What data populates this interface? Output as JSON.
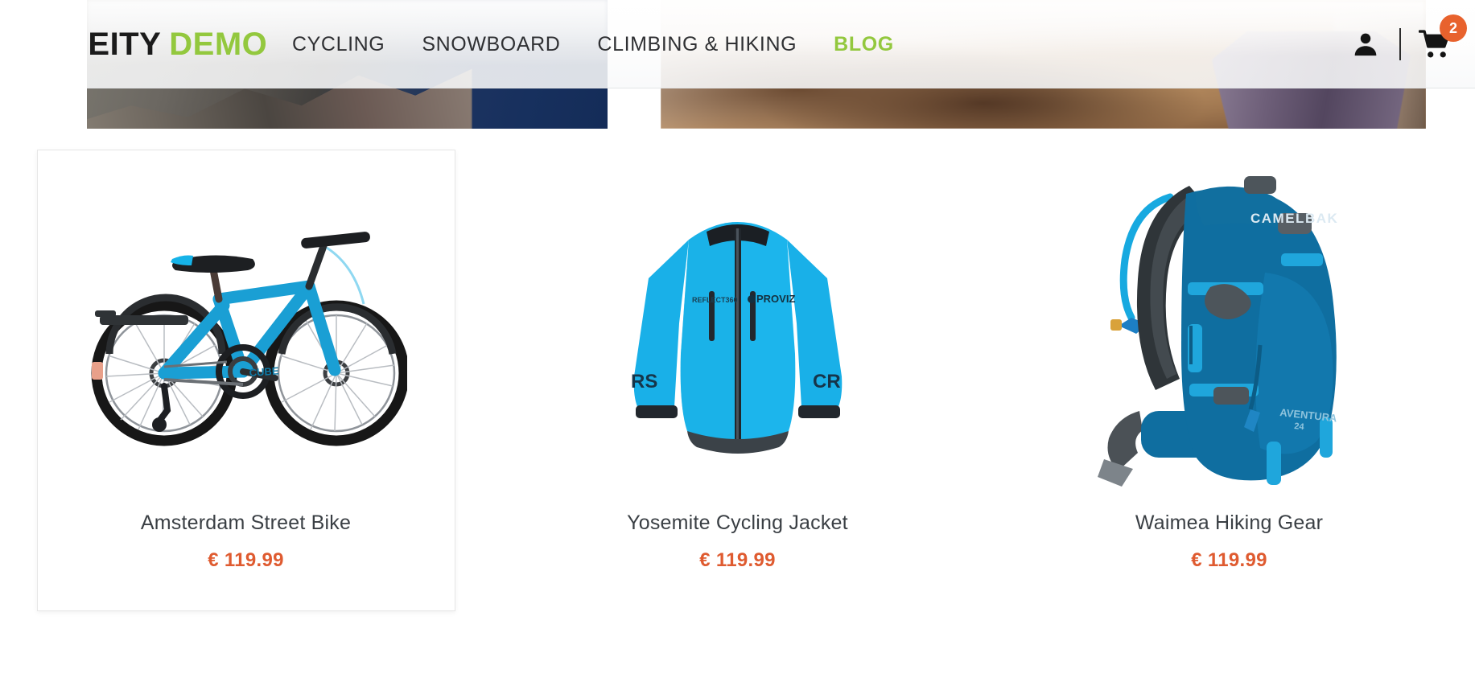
{
  "site": {
    "logo": {
      "mark_icon": "deity-hexagon-logo-icon",
      "name_primary": "DEITY",
      "name_secondary": "DEMO",
      "primary_color": "#1b1b1b",
      "secondary_color": "#93c83e"
    }
  },
  "header": {
    "nav": [
      {
        "label": "CYCLING",
        "active": false,
        "name": "nav-item-cycling"
      },
      {
        "label": "SNOWBOARD",
        "active": false,
        "name": "nav-item-snowboard"
      },
      {
        "label": "CLIMBING & HIKING",
        "active": false,
        "name": "nav-item-climbing-hiking"
      },
      {
        "label": "BLOG",
        "active": true,
        "name": "nav-item-blog"
      }
    ],
    "account_icon": "user-account-icon",
    "cart_icon": "shopping-cart-icon",
    "cart_count": "2",
    "cart_badge_color": "#e8622d",
    "active_nav_color": "#93c83e"
  },
  "hero": {
    "tiles": [
      {
        "name": "hero-banner-mountain",
        "alt": "rocky mountain ridge against deep blue sky"
      },
      {
        "name": "hero-banner-trail",
        "alt": "warm brown hiking trail with purple jacket"
      }
    ]
  },
  "products": [
    {
      "name": "product-card-amsterdam-street-bike",
      "title": "Amsterdam Street Bike",
      "price": "€ 119.99",
      "image_name": "bicycle-image",
      "hovered": true
    },
    {
      "name": "product-card-yosemite-cycling-jacket",
      "title": "Yosemite Cycling Jacket",
      "price": "€ 119.99",
      "image_name": "cycling-jacket-image",
      "hovered": false
    },
    {
      "name": "product-card-waimea-hiking-gear",
      "title": "Waimea Hiking Gear",
      "price": "€ 119.99",
      "image_name": "hiking-backpack-image",
      "hovered": false
    }
  ],
  "theme": {
    "price_color": "#df5b30",
    "title_color": "#3a3f44",
    "nav_color": "#2f3033",
    "card_border": "#e6e6e6"
  }
}
